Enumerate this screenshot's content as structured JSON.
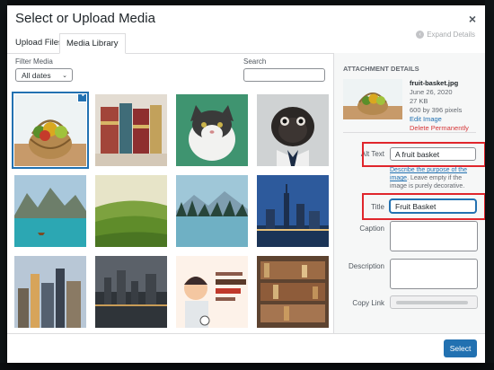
{
  "modal": {
    "title": "Select or Upload Media",
    "close_glyph": "×"
  },
  "tabs": [
    {
      "label": "Upload Files"
    },
    {
      "label": "Media Library"
    }
  ],
  "expand_details": "Expand Details",
  "filter": {
    "label": "Filter Media",
    "selected": "All dates"
  },
  "search": {
    "label": "Search",
    "value": ""
  },
  "attachment": {
    "heading": "Attachment Details",
    "filename": "fruit-basket.jpg",
    "date": "June 26, 2020",
    "size": "27 KB",
    "dimensions": "600 by 396 pixels",
    "edit_link": "Edit Image",
    "delete_link": "Delete Permanently"
  },
  "fields": {
    "alt_label": "Alt Text",
    "alt_value": "A fruit basket",
    "alt_hint_link": "Describe the purpose of the image",
    "alt_hint_rest": ". Leave empty if the image is purely decorative.",
    "title_label": "Title",
    "title_value": "Fruit Basket",
    "caption_label": "Caption",
    "description_label": "Description",
    "copy_link_label": "Copy Link"
  },
  "toolbar": {
    "select_label": "Select"
  },
  "colors": {
    "accent": "#2271b1",
    "highlight": "#e0262c",
    "danger": "#d63638"
  }
}
